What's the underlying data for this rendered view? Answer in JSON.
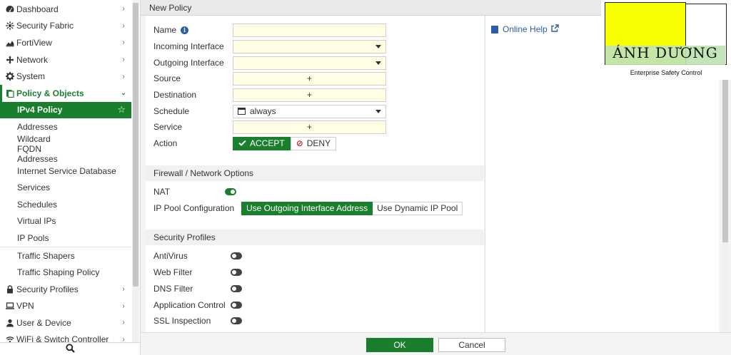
{
  "sidebar": {
    "menu": [
      {
        "icon": "dashboard-icon",
        "label": "Dashboard"
      },
      {
        "icon": "security-fabric-icon",
        "label": "Security Fabric"
      },
      {
        "icon": "fortiview-icon",
        "label": "FortiView"
      },
      {
        "icon": "network-icon",
        "label": "Network"
      },
      {
        "icon": "gear-icon",
        "label": "System"
      },
      {
        "icon": "policy-icon",
        "label": "Policy & Objects"
      }
    ],
    "policy_sub": [
      "IPv4 Policy",
      "Addresses",
      "Wildcard FQDN Addresses",
      "Internet Service Database",
      "Services",
      "Schedules",
      "Virtual IPs",
      "IP Pools",
      "Traffic Shapers",
      "Traffic Shaping Policy"
    ],
    "menu_after": [
      {
        "icon": "lock-icon",
        "label": "Security Profiles"
      },
      {
        "icon": "vpn-icon",
        "label": "VPN"
      },
      {
        "icon": "user-icon",
        "label": "User & Device"
      },
      {
        "icon": "wifi-icon",
        "label": "WiFi & Switch Controller"
      }
    ]
  },
  "page": {
    "title": "New Policy"
  },
  "form": {
    "name_label": "Name",
    "incoming_label": "Incoming Interface",
    "outgoing_label": "Outgoing Interface",
    "source_label": "Source",
    "destination_label": "Destination",
    "schedule_label": "Schedule",
    "schedule_value": "always",
    "service_label": "Service",
    "action_label": "Action",
    "accept_label": "ACCEPT",
    "deny_label": "DENY",
    "add_symbol": "+"
  },
  "firewall": {
    "section_title": "Firewall / Network Options",
    "nat_label": "NAT",
    "nat_enabled": true,
    "ippool_label": "IP Pool Configuration",
    "ippool_options": [
      "Use Outgoing Interface Address",
      "Use Dynamic IP Pool"
    ],
    "ippool_selected": "Use Outgoing Interface Address"
  },
  "security": {
    "section_title": "Security Profiles",
    "profiles": [
      {
        "label": "AntiVirus",
        "enabled": false
      },
      {
        "label": "Web Filter",
        "enabled": false
      },
      {
        "label": "DNS Filter",
        "enabled": false
      },
      {
        "label": "Application Control",
        "enabled": false
      },
      {
        "label": "SSL Inspection",
        "enabled": false
      }
    ]
  },
  "help": {
    "link_label": "Online Help"
  },
  "footer": {
    "ok_label": "OK",
    "cancel_label": "Cancel"
  },
  "watermark": {
    "brand": "ÁNH DƯƠNG",
    "tagline": "Enterprise Safety Control"
  },
  "colors": {
    "accent": "#1a7f2d",
    "field_bg": "#fffde4",
    "link": "#2a5ea8",
    "logo_yellow": "#f7ff00"
  }
}
